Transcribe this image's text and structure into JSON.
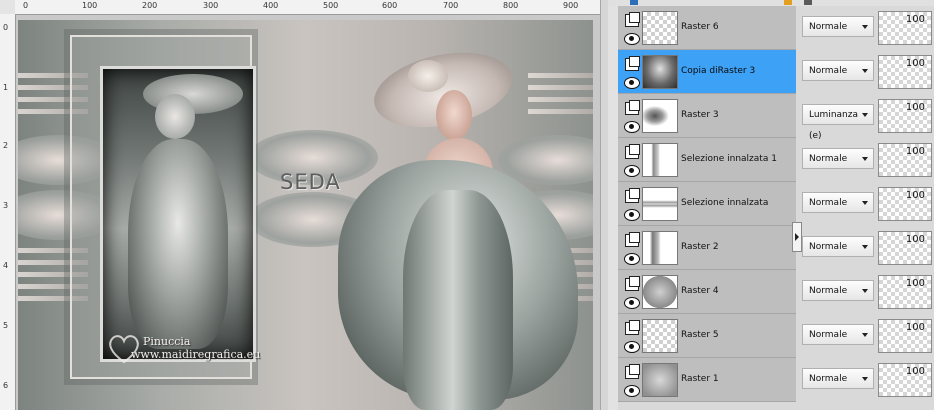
{
  "rulers": {
    "top_labels": [
      "0",
      "100",
      "200",
      "300",
      "400",
      "500",
      "600",
      "700",
      "800",
      "900"
    ],
    "left_labels": [
      "0",
      "1",
      "2",
      "3",
      "4",
      "5",
      "6"
    ]
  },
  "canvas": {
    "title_text": "SEDA",
    "watermark_line1": "Pinuccia",
    "watermark_line2": "www.maidiregrafica.eu"
  },
  "layers": [
    {
      "name": "Raster 6",
      "blend": "Normale",
      "opacity": "100",
      "selected": false
    },
    {
      "name": "Copia diRaster 3",
      "blend": "Normale",
      "opacity": "100",
      "selected": true
    },
    {
      "name": "Raster 3",
      "blend": "Luminanza (e)",
      "opacity": "100",
      "selected": false
    },
    {
      "name": "Selezione innalzata 1",
      "blend": "Normale",
      "opacity": "100",
      "selected": false
    },
    {
      "name": "Selezione innalzata",
      "blend": "Normale",
      "opacity": "100",
      "selected": false
    },
    {
      "name": "Raster 2",
      "blend": "Normale",
      "opacity": "100",
      "selected": false
    },
    {
      "name": "Raster 4",
      "blend": "Normale",
      "opacity": "100",
      "selected": false
    },
    {
      "name": "Raster 5",
      "blend": "Normale",
      "opacity": "100",
      "selected": false
    },
    {
      "name": "Raster 1",
      "blend": "Normale",
      "opacity": "100",
      "selected": false
    }
  ],
  "colors": {
    "selected_row": "#3da1f5",
    "row_bg": "#bebebe"
  }
}
